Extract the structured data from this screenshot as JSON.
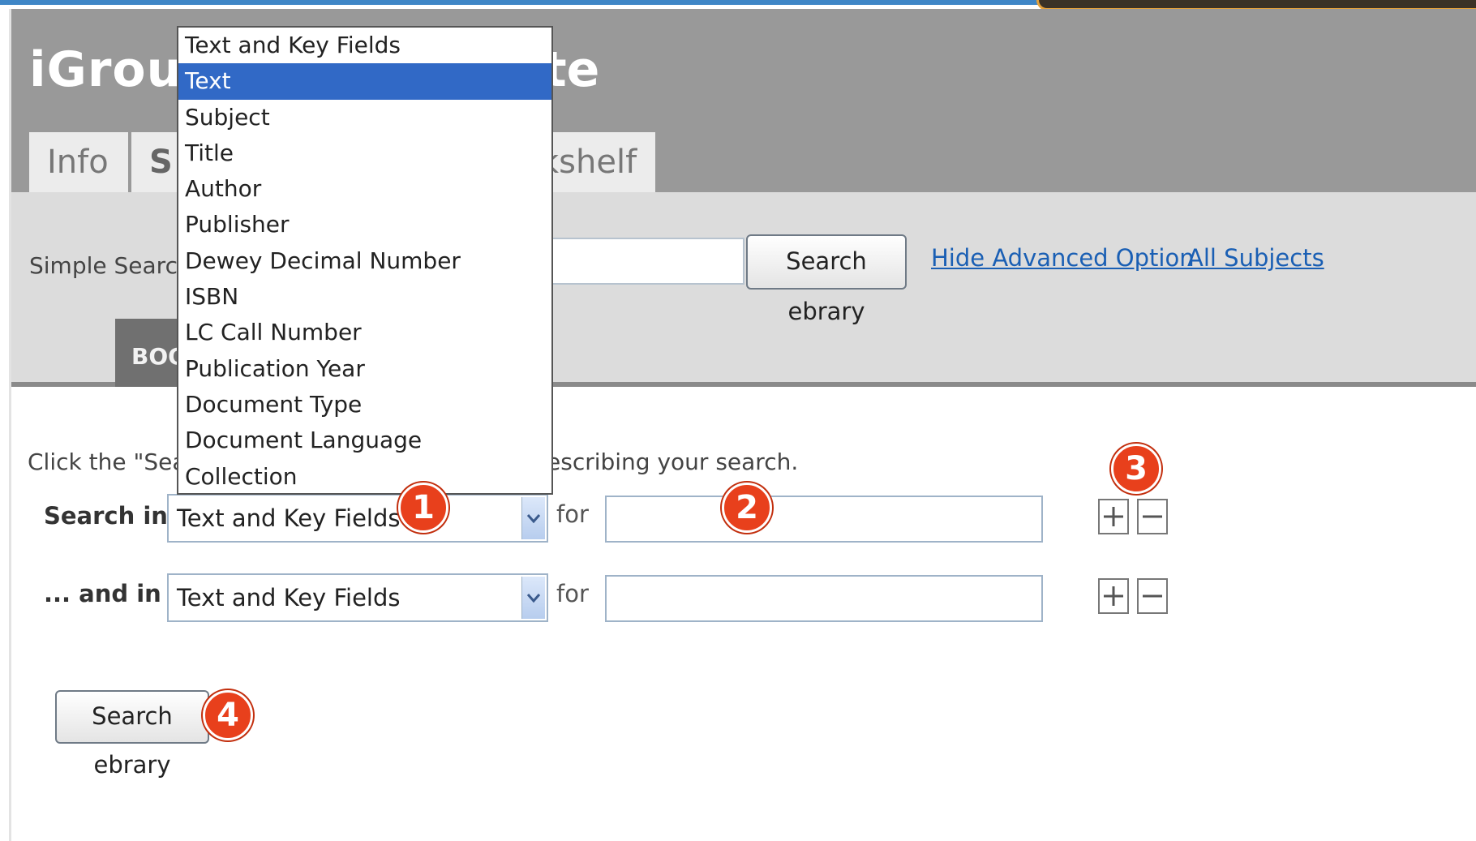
{
  "header": {
    "logo_text": "iGroup",
    "logo_tail": "te"
  },
  "tabs": {
    "info": "Info",
    "search": "S",
    "bookshelf": "kshelf"
  },
  "simple_search": {
    "label": "Simple Search:",
    "button": "Search ebrary",
    "hide_advanced_link": "Hide Advanced Option",
    "all_subjects_link": "All Subjects"
  },
  "books_tab": "BOO",
  "instructions": {
    "left": "Click the \"Sear",
    "right": "escribing your search."
  },
  "advanced": {
    "row1_label": "Search in",
    "row2_label": "... and in",
    "row1_select": "Text and Key Fields",
    "row2_select": "Text and Key Fields",
    "for_label": "for",
    "search_button": "Search ebrary"
  },
  "dropdown": {
    "selected_index": 1,
    "options": [
      "Text and Key Fields",
      "Text",
      "Subject",
      "Title",
      "Author",
      "Publisher",
      "Dewey Decimal Number",
      "ISBN",
      "LC Call Number",
      "Publication Year",
      "Document Type",
      "Document Language",
      "Collection"
    ]
  },
  "badges": [
    "1",
    "2",
    "3",
    "4"
  ],
  "colors": {
    "header_bg": "#999999",
    "selected_option": "#3169c6",
    "badge": "#e8401c",
    "link": "#1a5fb4"
  },
  "icons": {
    "plus": "plus-box-icon",
    "minus": "minus-box-icon",
    "dropdown_arrow": "chevron-down-icon"
  }
}
